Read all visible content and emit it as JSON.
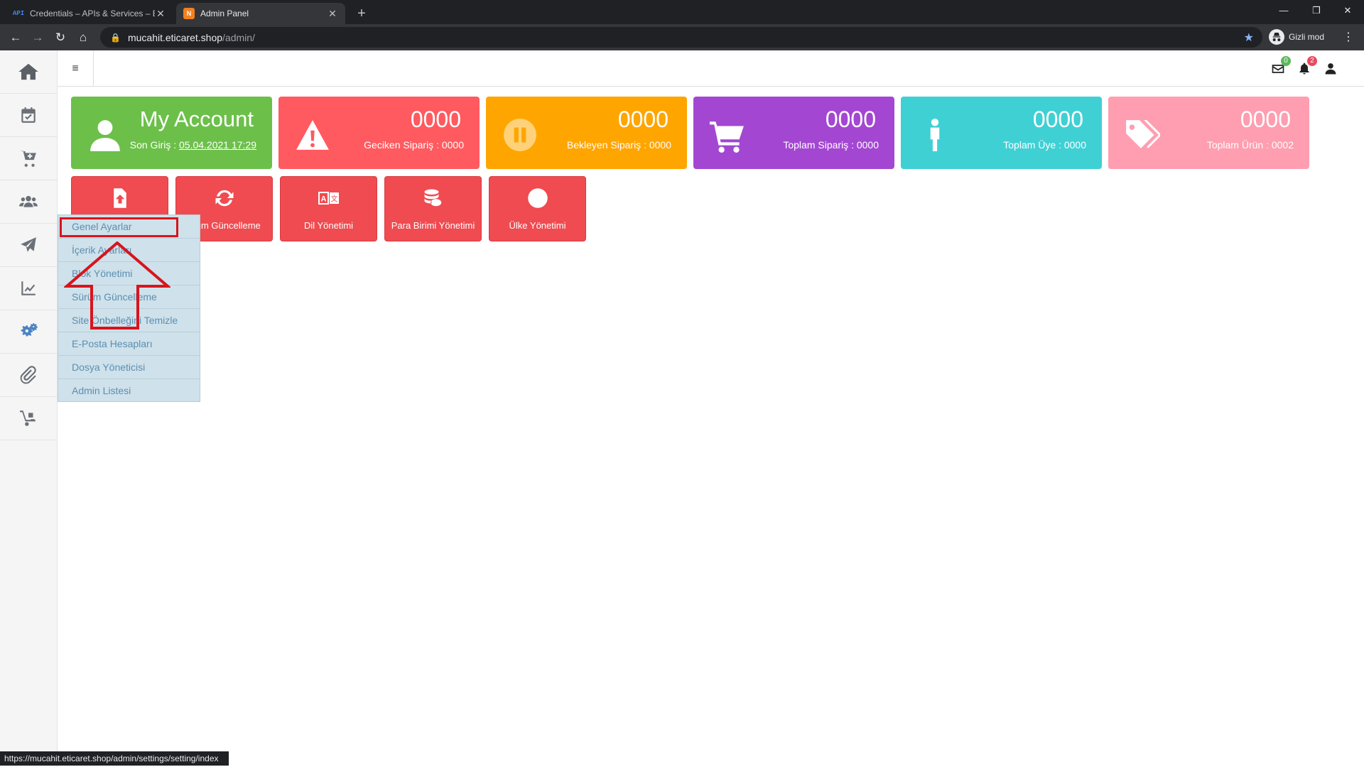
{
  "browser": {
    "tabs": [
      {
        "favicon": "API",
        "title": "Credentials – APIs & Services – E",
        "close": "✕"
      },
      {
        "favicon": "N",
        "title": "Admin Panel",
        "close": "✕"
      }
    ],
    "new_tab": "+",
    "url_host": "mucahit.eticaret.shop",
    "url_path": "/admin/",
    "incognito_label": "Gizli mod",
    "status_url": "https://mucahit.eticaret.shop/admin/settings/setting/index"
  },
  "sidebar": {
    "icons": [
      "home-icon",
      "calendar-check-icon",
      "cart-plus-icon",
      "users-icon",
      "paper-plane-icon",
      "chart-line-icon",
      "cogs-icon",
      "paperclip-icon",
      "dolly-icon"
    ]
  },
  "topnav": {
    "hamburger": "≡",
    "mail_badge": "0",
    "bell_badge": "2",
    "mail_badge_color": "#5cb85c",
    "bell_badge_color": "#e84a5f"
  },
  "cards": {
    "account": {
      "title": "My Account",
      "sub_prefix": "Son Giriş : ",
      "last_login": "05.04.2021 17:29",
      "color": "#6cc04a"
    },
    "late": {
      "number": "0000",
      "label": "Geciken Sipariş : 0000",
      "color": "#ff5a5f"
    },
    "pending": {
      "number": "0000",
      "label": "Bekleyen Sipariş : 0000",
      "color": "#ffa500"
    },
    "orders": {
      "number": "0000",
      "label": "Toplam Sipariş : 0000",
      "color": "#a347d2"
    },
    "members": {
      "number": "0000",
      "label": "Toplam Üye : 0000",
      "color": "#3fd0d4"
    },
    "products": {
      "number": "0000",
      "label": "Toplam Ürün : 0002",
      "color": "#ff9eb0"
    }
  },
  "tiles": [
    {
      "label": ""
    },
    {
      "label": "ürüm Güncelleme"
    },
    {
      "label": "Dil Yönetimi"
    },
    {
      "label": "Para Birimi Yönetimi"
    },
    {
      "label": "Ülke Yönetimi"
    }
  ],
  "dropdown": {
    "items": [
      "Genel Ayarlar",
      "İçerik Ayarları",
      "Blok Yönetimi",
      "Sürüm Güncelleme",
      "Site Önbelleğini Temizle",
      "E-Posta Hesapları",
      "Dosya Yöneticisi",
      "Admin Listesi"
    ]
  }
}
